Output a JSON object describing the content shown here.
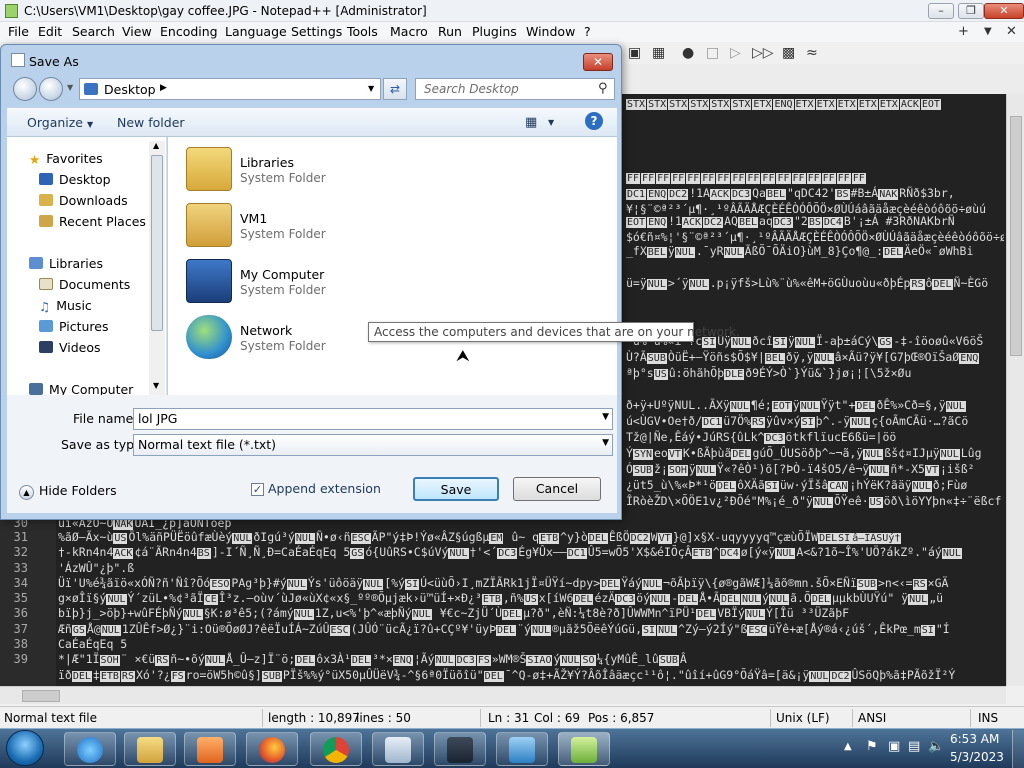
{
  "notepad": {
    "title": "C:\\Users\\VM1\\Desktop\\gay coffee.JPG - Notepad++ [Administrator]",
    "menu": [
      "File",
      "Edit",
      "Search",
      "View",
      "Encoding",
      "Language",
      "Settings",
      "Tools",
      "Macro",
      "Run",
      "Plugins",
      "Window",
      "?"
    ],
    "menu_right": [
      "+",
      "▼",
      "✕"
    ],
    "line_numbers": [
      "30",
      "31",
      "32",
      "33",
      "34",
      "35",
      "36",
      "37",
      "38",
      "39"
    ],
    "status": {
      "filetype": "Normal text file",
      "length": "length : 10,897",
      "lines": "lines : 50",
      "ln": "Ln : 31",
      "col": "Col : 69",
      "pos": "Pos : 6,857",
      "eol": "Unix (LF)",
      "encoding": "ANSI",
      "mode": "INS"
    }
  },
  "dialog": {
    "title": "Save As",
    "address": "Desktop",
    "search_placeholder": "Search Desktop",
    "organize": "Organize",
    "new_folder": "New folder",
    "nav": {
      "favorites": "Favorites",
      "desktop": "Desktop",
      "downloads": "Downloads",
      "recent": "Recent Places",
      "libraries": "Libraries",
      "documents": "Documents",
      "music": "Music",
      "pictures": "Pictures",
      "videos": "Videos",
      "computer": "My Computer"
    },
    "files": [
      {
        "name": "Libraries",
        "type": "System Folder"
      },
      {
        "name": "VM1",
        "type": "System Folder"
      },
      {
        "name": "My Computer",
        "type": "System Folder"
      },
      {
        "name": "Network",
        "type": "System Folder"
      }
    ],
    "tooltip": "Access the computers and devices that are on your network.",
    "file_name_label": "File name:",
    "file_name_value": "lol JPG",
    "save_type_label": "Save as type:",
    "save_type_value": "Normal text file (*.txt)",
    "hide_folders": "Hide Folders",
    "append_extension": "Append extension",
    "save": "Save",
    "cancel": "Cancel"
  },
  "taskbar": {
    "time": "6:53 AM",
    "date": "5/3/2023"
  }
}
